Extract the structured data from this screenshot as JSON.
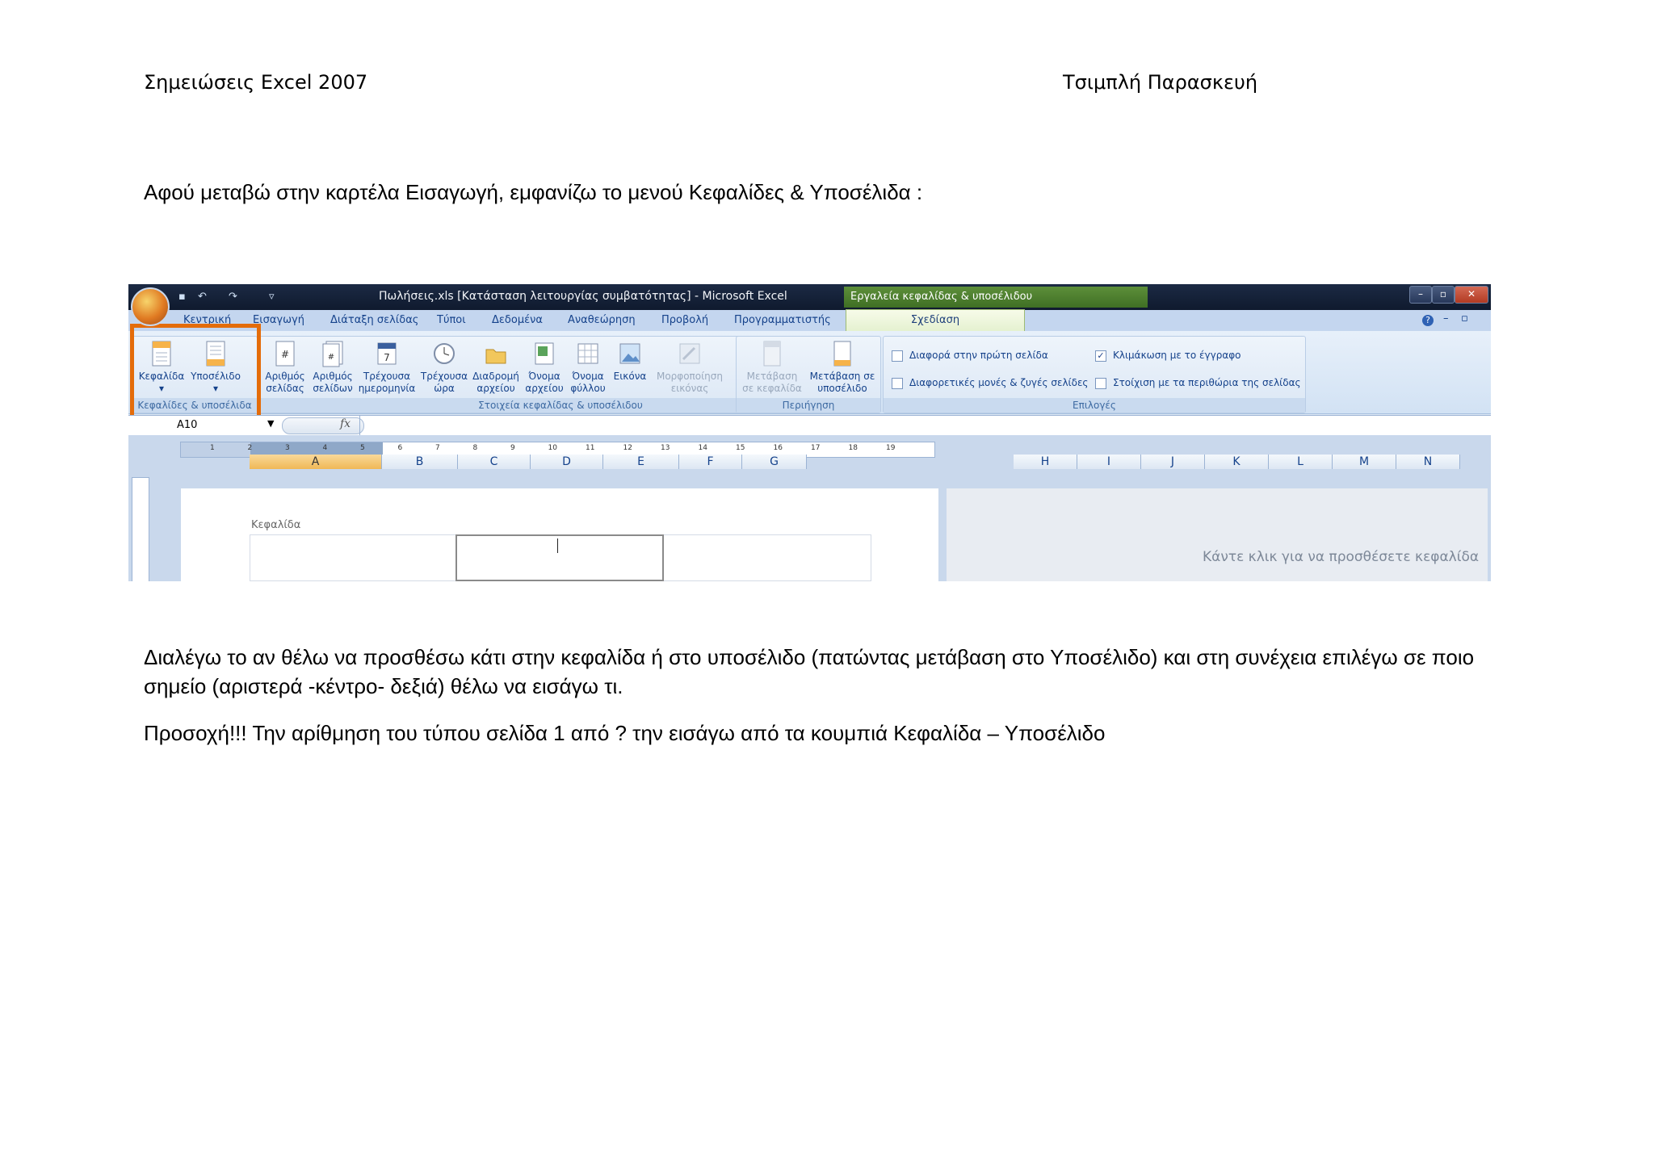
{
  "header": {
    "left": "Σημειώσεις Excel 2007",
    "right": "Τσιμπλή Παρασκευή"
  },
  "intro": "Αφού μεταβώ στην καρτέλα Εισαγωγή, εμφανίζω το μενού Κεφαλίδες & Υποσέλιδα :",
  "excel": {
    "title": "Πωλήσεις.xls  [Κατάσταση λειτουργίας συμβατότητας] - Microsoft Excel",
    "context_title": "Εργαλεία κεφαλίδας & υποσέλιδου",
    "tabs": [
      "Κεντρική",
      "Εισαγωγή",
      "Διάταξη σελίδας",
      "Τύποι",
      "Δεδομένα",
      "Αναθεώρηση",
      "Προβολή",
      "Προγραμματιστής"
    ],
    "active_tab": "Σχεδίαση",
    "group1": {
      "label": "Κεφαλίδες & υποσέλιδα",
      "buttons": [
        {
          "line1": "Κεφαλίδα",
          "line2": "▾"
        },
        {
          "line1": "Υποσέλιδο",
          "line2": "▾"
        }
      ]
    },
    "group2": {
      "label": "Στοιχεία κεφαλίδας & υποσέλιδου",
      "buttons": [
        {
          "line1": "Αριθμός",
          "line2": "σελίδας"
        },
        {
          "line1": "Αριθμός",
          "line2": "σελίδων"
        },
        {
          "line1": "Τρέχουσα",
          "line2": "ημερομηνία"
        },
        {
          "line1": "Τρέχουσα",
          "line2": "ώρα"
        },
        {
          "line1": "Διαδρομή",
          "line2": "αρχείου"
        },
        {
          "line1": "Όνομα",
          "line2": "αρχείου"
        },
        {
          "line1": "Όνομα",
          "line2": "φύλλου"
        },
        {
          "line1": "Εικόνα",
          "line2": ""
        },
        {
          "line1": "Μορφοποίηση",
          "line2": "εικόνας"
        }
      ]
    },
    "group3": {
      "label": "Περιήγηση",
      "buttons": [
        {
          "line1": "Μετάβαση",
          "line2": "σε κεφαλίδα"
        },
        {
          "line1": "Μετάβαση σε",
          "line2": "υποσέλιδο"
        }
      ]
    },
    "group4": {
      "label": "Επιλογές",
      "options": [
        {
          "label": "Διαφορά στην πρώτη σελίδα",
          "checked": false
        },
        {
          "label": "Κλιμάκωση με το έγγραφο",
          "checked": true
        },
        {
          "label": "Διαφορετικές μονές & ζυγές σελίδες",
          "checked": false
        },
        {
          "label": "Στοίχιση με τα περιθώρια της σελίδας",
          "checked": false
        }
      ],
      "check_mark": "✓"
    },
    "name_box": "A10",
    "fx_label": "fx",
    "ruler_numbers": [
      "1",
      "2",
      "3",
      "4",
      "5",
      "6",
      "7",
      "8",
      "9",
      "10",
      "11",
      "12",
      "13",
      "14",
      "15",
      "16",
      "17",
      "18",
      "19"
    ],
    "columns_left": [
      "A",
      "B",
      "C",
      "D",
      "E",
      "F",
      "G"
    ],
    "columns_right": [
      "H",
      "I",
      "J",
      "K",
      "L",
      "M",
      "N"
    ],
    "selected_column": "A",
    "header_label": "Κεφαλίδα",
    "click_to_add": "Κάντε κλικ για να προσθέσετε κεφαλίδα",
    "accent_color": "#e46c0a"
  },
  "para1": "Διαλέγω το αν θέλω να προσθέσω κάτι στην κεφαλίδα ή στο υποσέλιδο (πατώντας μετάβαση στο Υποσέλιδο) και στη συνέχεια επιλέγω σε ποιο σημείο (αριστερά -κέντρο- δεξιά) θέλω να εισάγω τι.",
  "para2": "Προσοχή!!! Την αρίθμηση του τύπου σελίδα 1 από ? την εισάγω από τα κουμπιά  Κεφαλίδα – Υποσέλιδο"
}
